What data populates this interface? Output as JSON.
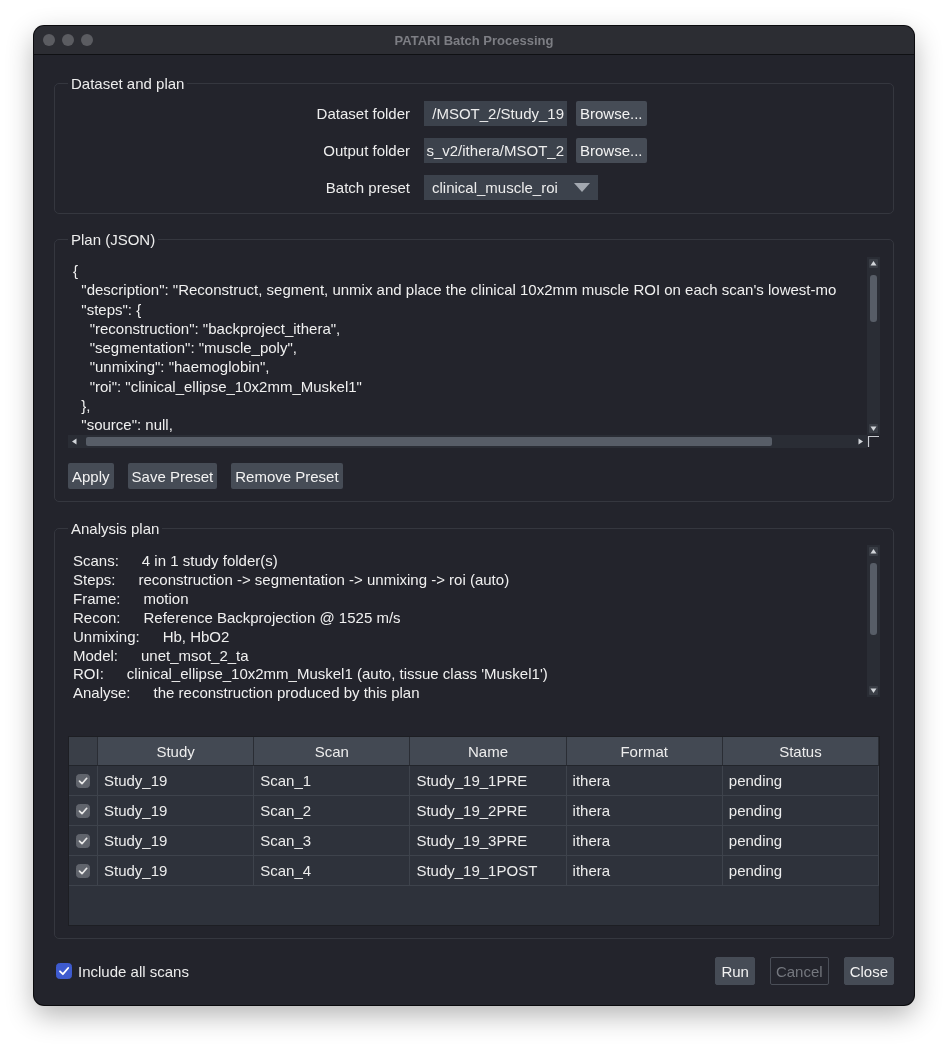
{
  "window": {
    "title": "PATARI Batch Processing"
  },
  "dataset_and_plan": {
    "title": "Dataset and plan",
    "fields": [
      {
        "kind": "path",
        "label": "Dataset folder",
        "value": "/MSOT_2/Study_19",
        "button": "Browse..."
      },
      {
        "kind": "path",
        "label": "Output folder",
        "value": "s_v2/ithera/MSOT_2",
        "button": "Browse..."
      },
      {
        "kind": "dropdown",
        "label": "Batch preset",
        "value": "clinical_muscle_roi"
      }
    ]
  },
  "plan_json": {
    "title": "Plan (JSON)",
    "lines": [
      "{",
      "  \"description\": \"Reconstruct, segment, unmix and place the clinical 10x2mm muscle ROI on each scan's lowest-mo",
      "  \"steps\": {",
      "    \"reconstruction\": \"backproject_ithera\",",
      "    \"segmentation\": \"muscle_poly\",",
      "    \"unmixing\": \"haemoglobin\",",
      "    \"roi\": \"clinical_ellipse_10x2mm_Muskel1\"",
      "  },",
      "  \"source\": null,"
    ],
    "buttons": [
      "Apply",
      "Save Preset",
      "Remove Preset"
    ]
  },
  "analysis_plan": {
    "title": "Analysis plan",
    "lines": [
      {
        "key": "Scans:",
        "value": "4 in 1 study folder(s)"
      },
      {
        "key": "Steps:",
        "value": "reconstruction -> segmentation -> unmixing -> roi (auto)"
      },
      {
        "key": "Frame:",
        "value": "motion"
      },
      {
        "key": "Recon:",
        "value": "Reference Backprojection @ 1525 m/s"
      },
      {
        "key": "Unmixing:",
        "value": "Hb, HbO2"
      },
      {
        "key": "Model:",
        "value": "unet_msot_2_ta"
      },
      {
        "key": "ROI:",
        "value": "clinical_ellipse_10x2mm_Muskel1 (auto, tissue class 'Muskel1')"
      },
      {
        "key": "Analyse:",
        "value": "the reconstruction produced by this plan"
      }
    ],
    "table": {
      "columns": [
        "Study",
        "Scan",
        "Name",
        "Format",
        "Status"
      ],
      "rows": [
        {
          "checked": true,
          "cells": [
            "Study_19",
            "Scan_1",
            "Study_19_1PRE",
            "ithera",
            "pending"
          ]
        },
        {
          "checked": true,
          "cells": [
            "Study_19",
            "Scan_2",
            "Study_19_2PRE",
            "ithera",
            "pending"
          ]
        },
        {
          "checked": true,
          "cells": [
            "Study_19",
            "Scan_3",
            "Study_19_3PRE",
            "ithera",
            "pending"
          ]
        },
        {
          "checked": true,
          "cells": [
            "Study_19",
            "Scan_4",
            "Study_19_1POST",
            "ithera",
            "pending"
          ]
        }
      ]
    }
  },
  "footer": {
    "include_all": {
      "label": "Include all scans",
      "checked": true
    },
    "buttons": [
      {
        "label": "Run",
        "disabled": false
      },
      {
        "label": "Cancel",
        "disabled": true
      },
      {
        "label": "Close",
        "disabled": false
      }
    ]
  }
}
